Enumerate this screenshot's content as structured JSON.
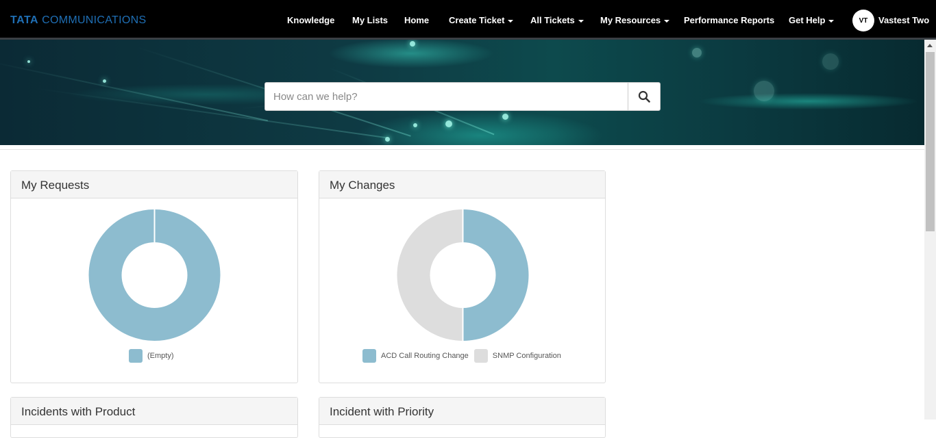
{
  "header": {
    "logo_bold": "TATA",
    "logo_rest": "COMMUNICATIONS",
    "nav": [
      {
        "label": "Knowledge",
        "dropdown": false
      },
      {
        "label": "My Lists",
        "dropdown": false
      },
      {
        "label": "Home",
        "dropdown": false
      },
      {
        "label": "Create Ticket",
        "dropdown": true
      },
      {
        "label": "All Tickets",
        "dropdown": true
      },
      {
        "label": "My Resources",
        "dropdown": true
      },
      {
        "label": "Performance Reports",
        "dropdown": false
      },
      {
        "label": "Get Help",
        "dropdown": true
      }
    ],
    "user_initials": "VT",
    "user_name": "Vastest Two"
  },
  "search": {
    "placeholder": "How can we help?",
    "icon": "search-icon"
  },
  "panels": [
    {
      "title": "My Requests",
      "chart_type": "donut",
      "segments": [
        {
          "label": "(Empty)",
          "value": 1,
          "color": "#8dbccf"
        }
      ]
    },
    {
      "title": "My Changes",
      "chart_type": "donut",
      "segments": [
        {
          "label": "ACD Call Routing Change",
          "value": 1,
          "color": "#8dbccf"
        },
        {
          "label": "SNMP Configuration",
          "value": 1,
          "color": "#dddddd"
        }
      ]
    },
    {
      "title": "Incidents with Product"
    },
    {
      "title": "Incident with Priority"
    }
  ],
  "colors": {
    "nav_bg": "#000000",
    "logo": "#1f6fb5",
    "segment_blue": "#8dbccf",
    "segment_grey": "#dddddd"
  }
}
